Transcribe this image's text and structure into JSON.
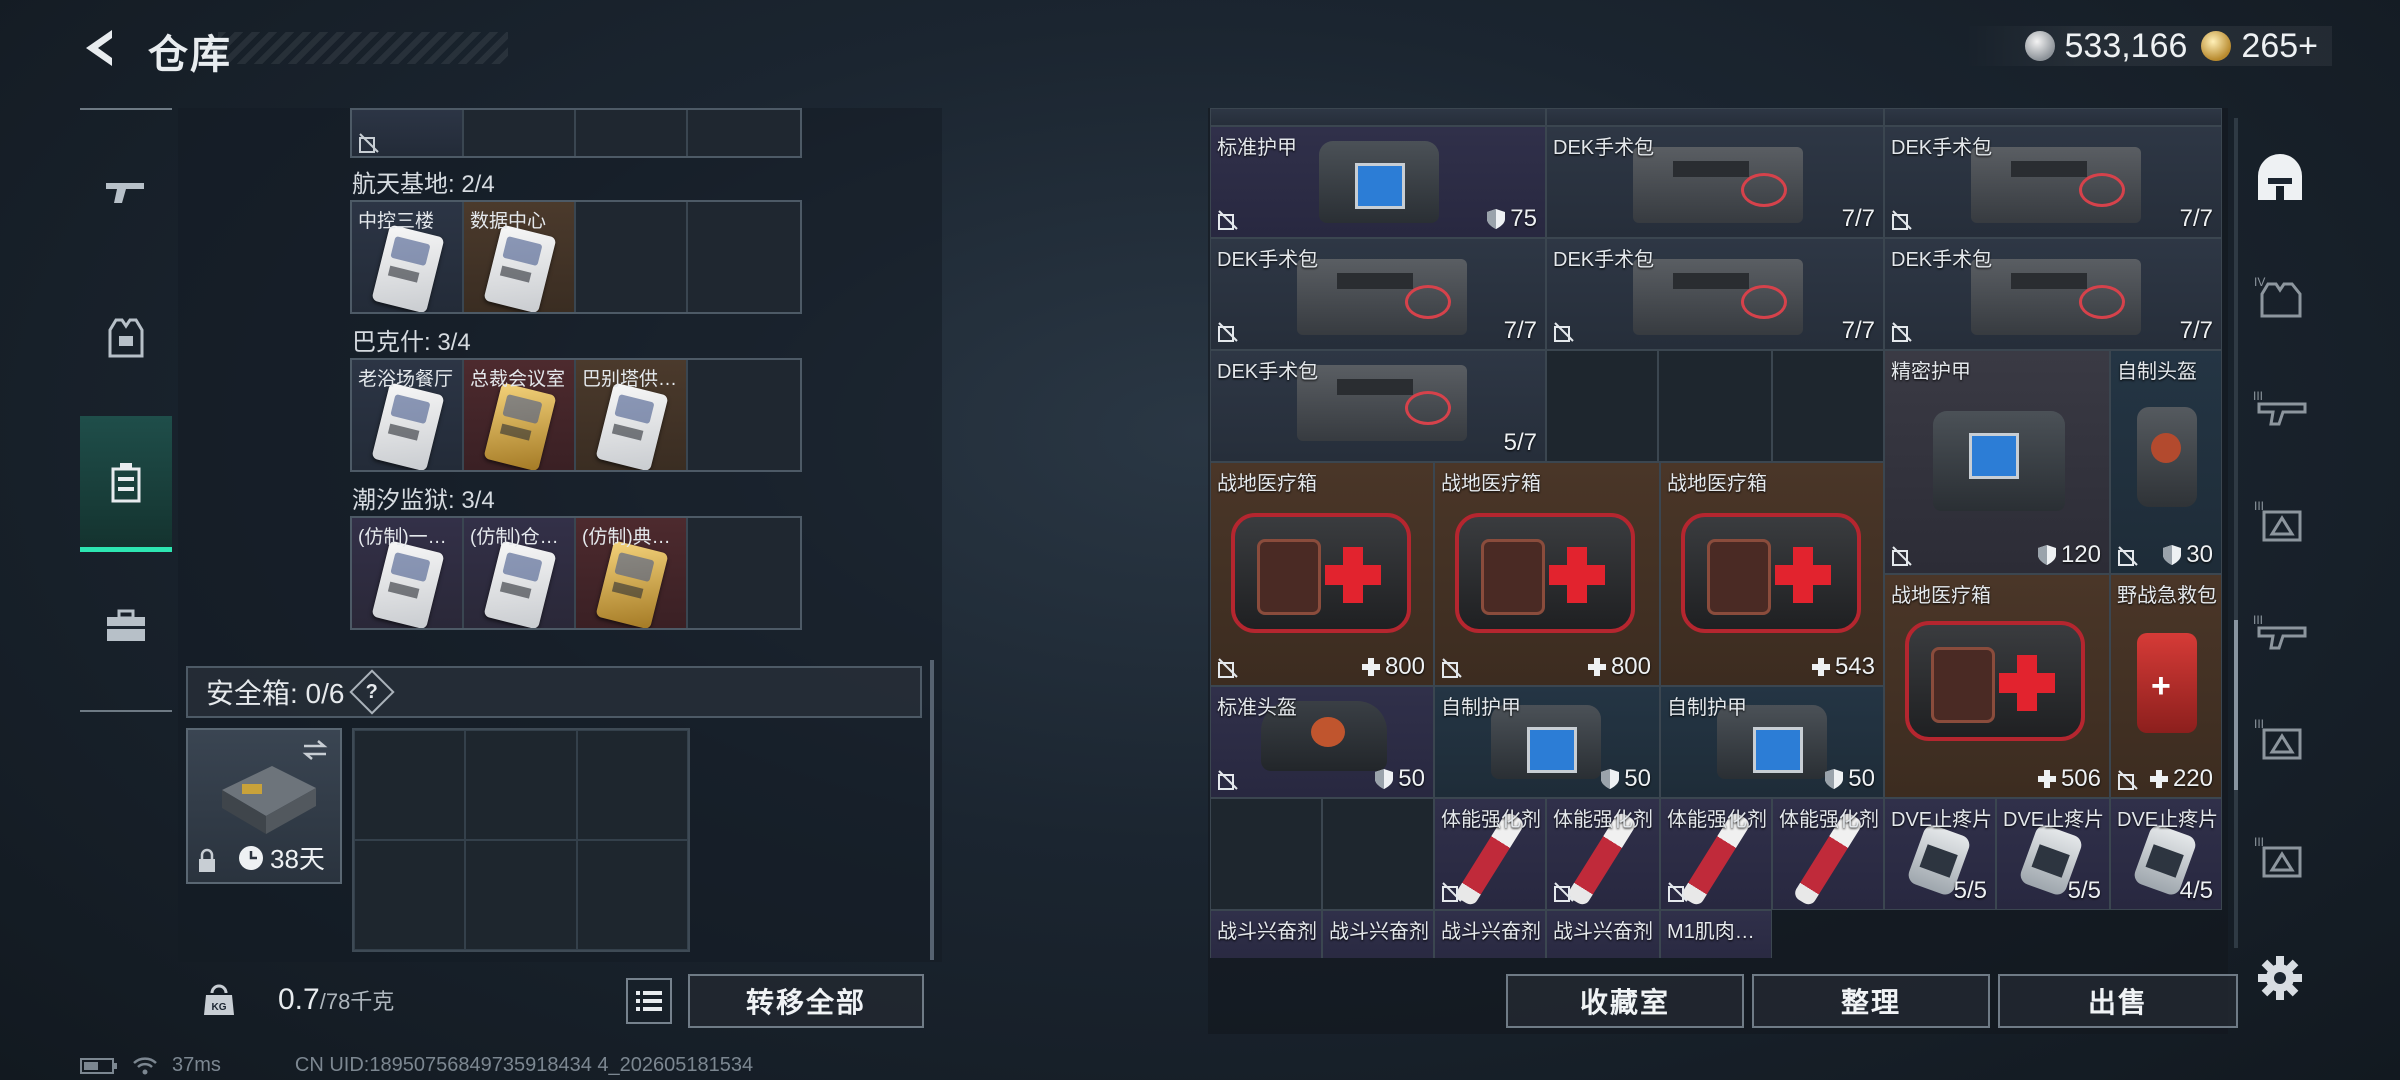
{
  "header": {
    "title": "仓库"
  },
  "currency": [
    {
      "icon": "silver-coin-icon",
      "value": "533,166"
    },
    {
      "icon": "gold-coin-icon",
      "value": "265+"
    }
  ],
  "left_nav": [
    {
      "icon": "gun-icon",
      "active": false
    },
    {
      "icon": "vest-icon",
      "active": false
    },
    {
      "icon": "keycard-case-icon",
      "active": true
    },
    {
      "icon": "briefcase-icon",
      "active": false
    }
  ],
  "key_groups": [
    {
      "title": "航天基地: 2/4",
      "slots": [
        {
          "label": "中控三楼",
          "rarity": "white"
        },
        {
          "label": "数据中心",
          "rarity": "orange"
        }
      ]
    },
    {
      "title": "巴克什: 3/4",
      "slots": [
        {
          "label": "老浴场餐厅",
          "rarity": "white"
        },
        {
          "label": "总裁会议室",
          "rarity": "red"
        },
        {
          "label": "巴别塔供…",
          "rarity": "orange"
        }
      ]
    },
    {
      "title": "潮汐监狱: 3/4",
      "slots": [
        {
          "label": "(仿制)一…",
          "rarity": "purple"
        },
        {
          "label": "(仿制)仓…",
          "rarity": "purple"
        },
        {
          "label": "(仿制)典…",
          "rarity": "red"
        }
      ]
    }
  ],
  "safebox": {
    "label": "安全箱: 0/6",
    "help": "?",
    "expire": "38天"
  },
  "weight": {
    "current": "0.7",
    "max": "/78千克"
  },
  "buttons": {
    "transfer_all": "转移全部",
    "collection": "收藏室",
    "sort": "整理",
    "sell": "出售"
  },
  "inventory": {
    "row1": [
      {
        "label": "标准护甲",
        "count": "75",
        "count_icon": "shield-icon"
      },
      {
        "label": "DEK手术包",
        "count": "7/7"
      },
      {
        "label": "DEK手术包",
        "count": "7/7"
      }
    ],
    "row2": [
      {
        "label": "DEK手术包",
        "count": "7/7"
      },
      {
        "label": "DEK手术包",
        "count": "7/7"
      },
      {
        "label": "DEK手术包",
        "count": "7/7"
      }
    ],
    "row3": [
      {
        "label": "DEK手术包",
        "count": "5/7"
      }
    ],
    "precision_armor": {
      "label": "精密护甲",
      "count": "120"
    },
    "self_helmet": {
      "label": "自制头盔",
      "count": "30"
    },
    "medboxes": [
      {
        "label": "战地医疗箱",
        "count": "800"
      },
      {
        "label": "战地医疗箱",
        "count": "800"
      },
      {
        "label": "战地医疗箱",
        "count": "543"
      },
      {
        "label": "战地医疗箱",
        "count": "506"
      }
    ],
    "field_kit": {
      "label": "野战急救包",
      "count": "220"
    },
    "row6": [
      {
        "label": "标准头盔",
        "count": "50"
      },
      {
        "label": "自制护甲",
        "count": "50"
      },
      {
        "label": "自制护甲",
        "count": "50"
      }
    ],
    "injectors": [
      {
        "label": "体能强化剂"
      },
      {
        "label": "体能强化剂"
      },
      {
        "label": "体能强化剂"
      },
      {
        "label": "体能强化剂"
      }
    ],
    "pills": [
      {
        "label": "DVE止疼片",
        "count": "5/5"
      },
      {
        "label": "DVE止疼片",
        "count": "5/5"
      },
      {
        "label": "DVE止疼片",
        "count": "4/5"
      }
    ],
    "row8": [
      {
        "label": "战斗兴奋剂"
      },
      {
        "label": "战斗兴奋剂"
      },
      {
        "label": "战斗兴奋剂"
      },
      {
        "label": "战斗兴奋剂"
      },
      {
        "label": "M1肌肉…"
      }
    ]
  },
  "right_nav": [
    "helmet-slot-icon",
    "armor-iv-icon",
    "gun-iii-icon",
    "armor-iii-icon",
    "gun-iii-icon-2",
    "armor-iii-icon-2",
    "armor-iii-icon-3"
  ],
  "status": {
    "ping": "37ms",
    "uid": "CN UID:18950756849735918434 4_202605181534"
  }
}
